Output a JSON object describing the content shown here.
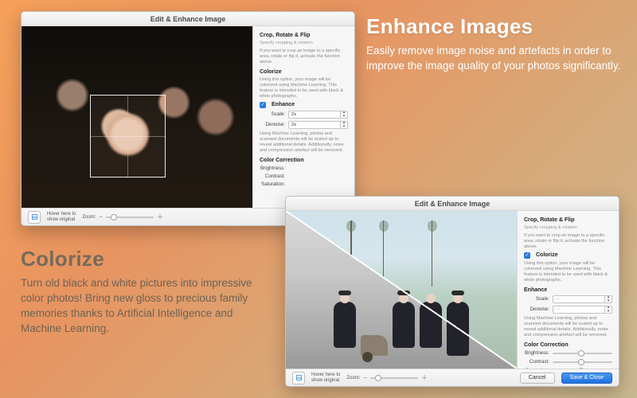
{
  "promo_enhance": {
    "title": "Enhance Images",
    "body": "Easily remove image noise and artefacts in order to improve the image quality of your photos significantly."
  },
  "promo_colorize": {
    "title": "Colorize",
    "body": "Turn old black and white pictures into impressive color photos! Bring new gloss to precious family memories thanks to Artificial Intelligence and Machine Learning."
  },
  "dialog": {
    "title": "Edit & Enhance Image",
    "hover_label": "Hover here to\nshow original",
    "zoom_label": "Zoom:",
    "cancel": "Cancel",
    "save": "Save & Close"
  },
  "panel": {
    "crop": {
      "title": "Crop, Rotate & Flip",
      "subtitle": "Specify cropping & rotation",
      "desc": "If you want to crop an image to a specific area, rotate or flip it, activate the function above."
    },
    "colorize": {
      "title": "Colorize",
      "desc": "Using this option, your image will be colorized using Machine Learning. This feature is intended to be used with black & white photographs."
    },
    "enhance": {
      "title": "Enhance",
      "scale_label": "Scale:",
      "scale_val": "2x",
      "denoise_label": "Denoise:",
      "denoise_val": "2x",
      "desc": "Using Machine Learning, photos and scanned documents will be scaled up to reveal additional details. Additionally, noise and compression artefact will be removed."
    },
    "cc": {
      "title": "Color Correction",
      "brightness": "Brightness:",
      "contrast": "Contrast:",
      "saturation": "Saturation:"
    }
  }
}
